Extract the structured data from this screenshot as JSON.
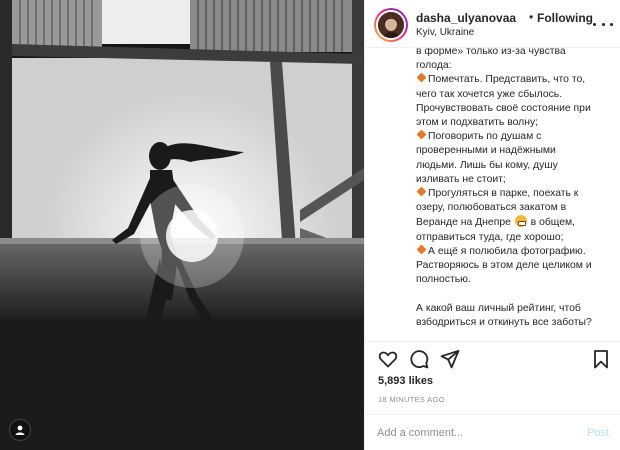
{
  "post": {
    "username": "dasha_ulyanovaa",
    "dot": "•",
    "follow_state": "Following",
    "location": "Kyiv, Ukraine",
    "caption_lines": [
      "в форме» только из-за чувства",
      "голода:",
      "Помечтать. Представить, что то,",
      "чего так хочется уже сбылось.",
      "Прочувствовать своё состояние при",
      "этом и подхватить волну;",
      "Поговорить по душам с",
      "проверенными и надёжными",
      "людьми. Лишь бы кому, душу",
      "изливать не стоит;",
      "Прогуляться в парке, поехать к",
      "озеру, полюбоваться закатом в",
      "Веранде на Днепре",
      "в общем,",
      "отправиться туда, где хорошо;",
      "А ещё я полюбила фотографию.",
      "Растворяюсь в этом деле целиком и",
      "полностью.",
      "А какой ваш личный рейтинг, чтоб",
      "взбодриться и откинуть все заботы?"
    ],
    "likes": "5,893 likes",
    "time": "18 MINUTES AGO",
    "comment_placeholder": "Add a comment...",
    "post_label": "Post"
  },
  "icons": {
    "bullet": "orange-diamond-icon",
    "emoji": "grinning-face-icon",
    "like": "heart-icon",
    "comment": "comment-bubble-icon",
    "share": "paper-plane-icon",
    "save": "bookmark-icon",
    "more": "more-options-icon",
    "tag": "user-tag-icon"
  },
  "colors": {
    "post_button": "#b2dffc",
    "bullet": "#e07b2a",
    "text": "#262626",
    "secondary_text": "#8e8e8e"
  }
}
